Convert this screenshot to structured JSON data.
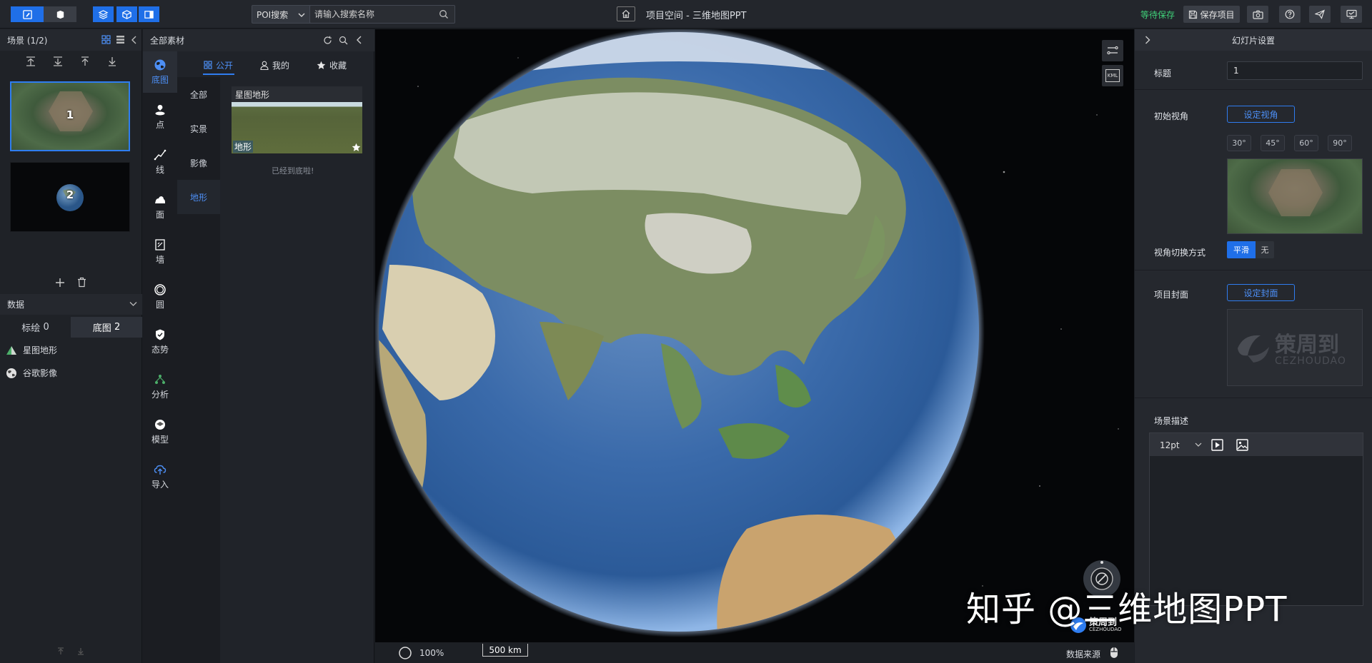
{
  "topbar": {
    "window_title": "项目空间 - 三维地图PPT",
    "poi_select": "POI搜索",
    "search_placeholder": "请输入搜索名称",
    "save_status": "等待保存",
    "save_label": "保存项目"
  },
  "scene_panel": {
    "title": "场景 (1/2)",
    "scenes": [
      {
        "number": "1"
      },
      {
        "number": "2"
      }
    ]
  },
  "data_panel": {
    "title": "数据",
    "tabs": [
      {
        "label": "标绘",
        "count": "0"
      },
      {
        "label": "底图",
        "count": "2"
      }
    ],
    "items": [
      "星图地形",
      "谷歌影像"
    ]
  },
  "material_panel": {
    "title": "全部素材",
    "tabs": [
      "公开",
      "我的",
      "收藏"
    ],
    "categories": [
      "全部",
      "实景",
      "影像",
      "地形"
    ],
    "card": {
      "title": "星图地形",
      "tag": "地形"
    },
    "bottom_msg": "已经到底啦!"
  },
  "vertical_tools": [
    "底图",
    "点",
    "线",
    "面",
    "墙",
    "圆",
    "态势",
    "分析",
    "模型",
    "导入"
  ],
  "map": {
    "zoom": "100%",
    "scale": "500 km",
    "data_source": "数据来源",
    "kml_label": "KML",
    "watermark": "知乎 @三维地图PPT",
    "logo_cn": "策周到",
    "logo_en": "CEZHOUDAO"
  },
  "right_panel": {
    "title": "幻灯片设置",
    "title_label": "标题",
    "title_value": "1",
    "initial_view_label": "初始视角",
    "set_view_btn": "设定视角",
    "angles": [
      "30°",
      "45°",
      "60°",
      "90°"
    ],
    "switch_label": "视角切换方式",
    "switch_options": [
      "平滑",
      "无"
    ],
    "cover_label": "项目封面",
    "set_cover_btn": "设定封面",
    "cover_logo_cn": "策周到",
    "cover_logo_en": "CEZHOUDAO",
    "desc_label": "场景描述",
    "font_size": "12pt"
  },
  "colors": {
    "accent": "#1f6fe8",
    "save_status": "#3fcf78",
    "bg": "#1b1e23"
  }
}
